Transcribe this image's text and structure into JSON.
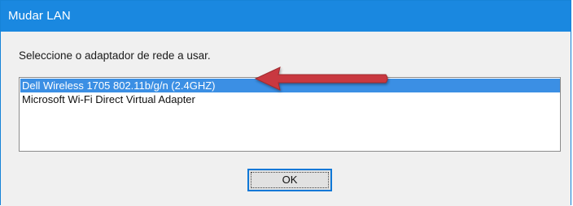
{
  "window": {
    "title": "Mudar LAN"
  },
  "dialog": {
    "prompt": "Seleccione o adaptador de rede a usar.",
    "adapters": [
      {
        "label": "Dell Wireless 1705 802.11b/g/n (2.4GHZ)",
        "selected": true
      },
      {
        "label": "Microsoft Wi-Fi Direct Virtual Adapter",
        "selected": false
      }
    ],
    "ok_label": "OK"
  },
  "colors": {
    "titlebar": "#1a88e0",
    "selection": "#3b8fe4",
    "annotation_arrow": "#c9393f"
  }
}
